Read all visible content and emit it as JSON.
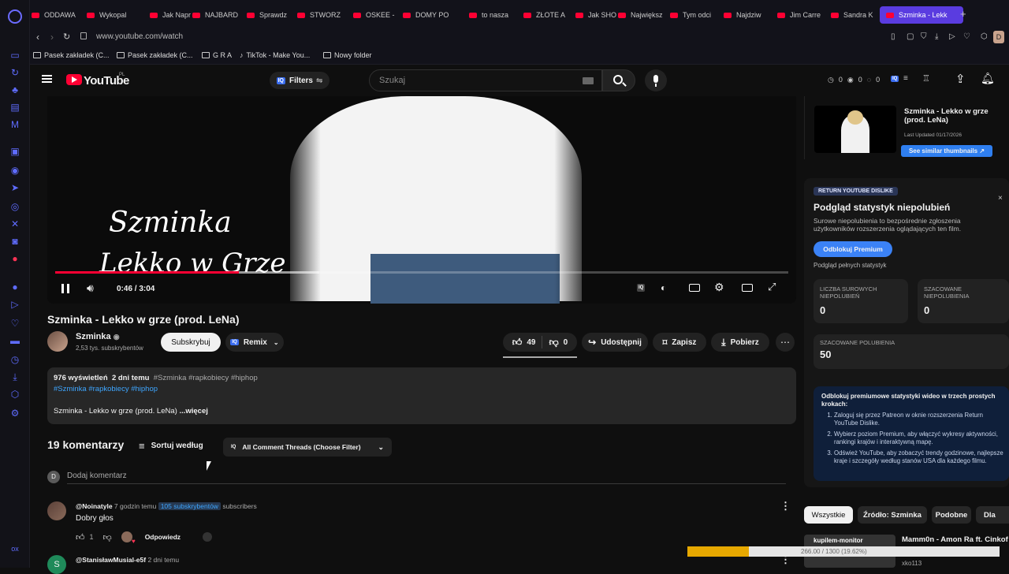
{
  "browser": {
    "tabs": [
      {
        "label": "ODDAWA"
      },
      {
        "label": "Wykopal"
      },
      {
        "label": "Jak Napr"
      },
      {
        "label": "NAJBARD"
      },
      {
        "label": "Sprawdz"
      },
      {
        "label": "STWORZ"
      },
      {
        "label": "OSKEE -"
      },
      {
        "label": "DOMY PO"
      },
      {
        "label": "to nasza"
      },
      {
        "label": "ZŁOTE A"
      },
      {
        "label": "Jak SHO"
      },
      {
        "label": "Największ"
      },
      {
        "label": "Tym odci"
      },
      {
        "label": "Najdziw"
      },
      {
        "label": "Jim Carre"
      },
      {
        "label": "Sandra K"
      },
      {
        "label": "Szminka - Lekk"
      }
    ],
    "url": "www.youtube.com/watch",
    "bookmarks": [
      {
        "label": "Pasek zakładek (C..."
      },
      {
        "label": "Pasek zakładek (C..."
      },
      {
        "label": "G R A"
      },
      {
        "label": "TikTok - Make You..."
      },
      {
        "label": "Nowy folder"
      }
    ],
    "avatar_letter": "D"
  },
  "header": {
    "logo": "YouTube",
    "country": "PL",
    "filters_label": "Filters",
    "search_placeholder": "Szukaj",
    "stats": [
      "0",
      "0",
      "0"
    ]
  },
  "player": {
    "overlay_line1": "Szminka",
    "overlay_line2": "Lekko w Grze",
    "time": "0:46 / 3:04",
    "progress": 0.25,
    "buffered": 0.36
  },
  "video": {
    "title": "Szminka - Lekko w grze (prod. LeNa)",
    "channel": "Szminka",
    "subscribers": "2,53 tys. subskrybentów",
    "subscribe_label": "Subskrybuj",
    "remix_label": "Remix",
    "likes": "49",
    "dislikes": "0",
    "share_label": "Udostępnij",
    "save_label": "Zapisz",
    "download_label": "Pobierz"
  },
  "description": {
    "views": "976 wyświetleń",
    "date": "2 dni temu",
    "tags_inline": "#Szminka #rapkobiecy #hiphop",
    "tags": "#Szminka #rapkobiecy #hiphop",
    "text": "Szminka - Lekko w grze (prod. LeNa)",
    "more": "...więcej"
  },
  "comments": {
    "count_label": "19 komentarzy",
    "sort_label": "Sortuj według",
    "filter_label": "All Comment Threads (Choose Filter)",
    "add_placeholder": "Dodaj komentarz",
    "user_initial": "D",
    "items": [
      {
        "author": "@Noinatyle",
        "time": "7 godzin temu",
        "badge": "105 subskrybentów",
        "badge_suffix": "subscribers",
        "text": "Dobry głos",
        "likes": "1",
        "reply": "Odpowiedz"
      },
      {
        "author": "@StanisławMusial-e5f",
        "time": "2 dni temu",
        "initial": "S"
      }
    ]
  },
  "sidebar": {
    "thumb_title": "Szminka - Lekko w grze (prod. LeNa)",
    "last_updated": "Last Updated 01/17/2026",
    "similar_label": "See similar thumbnails",
    "rd_badge": "RETURN YOUTUBE DISLIKE",
    "rd_title": "Podgląd statystyk niepolubień",
    "rd_desc": "Surowe niepolubienia to bezpośrednie zgłoszenia użytkowników rozszerzenia oglądających ten film.",
    "rd_button": "Odblokuj Premium",
    "rd_preview": "Podgląd pełnych statystyk",
    "stat1_label": "LICZBA SUROWYCH NIEPOLUBIEŃ",
    "stat1_value": "0",
    "stat2_label": "SZACOWANE NIEPOLUBIENIA",
    "stat2_value": "0",
    "stat3_label": "SZACOWANE POLUBIENIA",
    "stat3_value": "50",
    "steps_title": "Odblokuj premiumowe statystyki wideo w trzech prostych krokach:",
    "steps": [
      "Zaloguj się przez Patreon w oknie rozszerzenia Return YouTube Dislike.",
      "Wybierz poziom Premium, aby włączyć wykresy aktywności, rankingi krajów i interaktywną mapę.",
      "Odśwież YouTube, aby zobaczyć trendy godzinowe, najlepsze kraje i szczegóły według stanów USA dla każdego filmu."
    ],
    "chips": [
      "Wszystkie",
      "Źródło: Szminka",
      "Podobne",
      "Dla"
    ],
    "rec_title": "Mamm0n - Amon Ra ft. Cinkof",
    "rec_channel": "xko113",
    "rec_thumb_text": "kupilem-monitor",
    "download_bar_text": "266.00 / 1300 (19.62%)"
  }
}
